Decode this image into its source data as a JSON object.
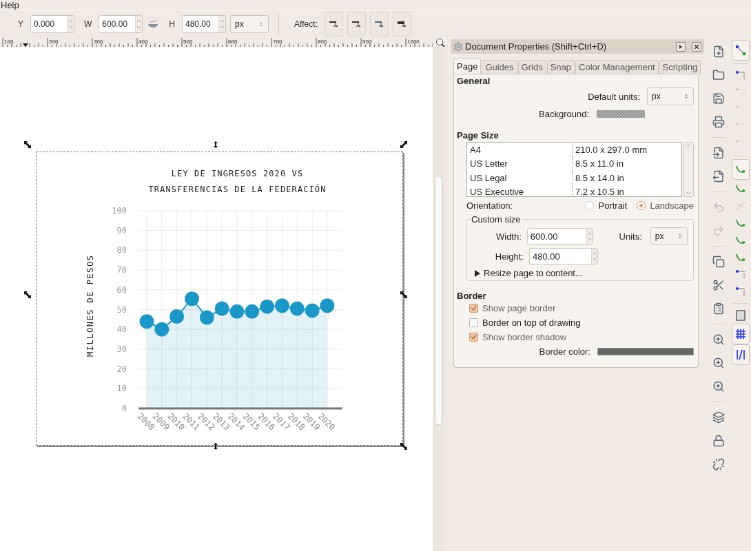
{
  "menu": {
    "items": [
      "Help"
    ]
  },
  "toolbar": {
    "y_label": "Y",
    "y_value": "0.000",
    "w_label": "W",
    "w_value": "600.00",
    "h_label": "H",
    "h_value": "480.00",
    "unit": "px",
    "affect_label": "Affect:"
  },
  "ruler": {
    "labels": [
      "100",
      "200",
      "300",
      "400",
      "500",
      "600",
      "700",
      "800",
      "900",
      "1000"
    ]
  },
  "canvas": {
    "chart_data": {
      "type": "area",
      "title": "LEY DE INGRESOS 2020 VS TRANSFERENCIAS DE LA FEDERACIÓN",
      "ylabel": "MILLONES DE PESOS",
      "categories": [
        "2008",
        "2009",
        "2010",
        "2011",
        "2012",
        "2013",
        "2014",
        "2015",
        "2016",
        "2017",
        "2018",
        "2019",
        "2020"
      ],
      "values": [
        44,
        40,
        46.5,
        55.5,
        46,
        50.5,
        49,
        49,
        51.5,
        52,
        50.5,
        49.5,
        52
      ],
      "color": "#1a97c9",
      "grid": true,
      "ylim": [
        0,
        100
      ],
      "yticks": [
        0,
        10,
        20,
        30,
        40,
        50,
        60,
        70,
        80,
        90,
        100
      ]
    }
  },
  "panel": {
    "title": "Document Properties (Shift+Ctrl+D)",
    "tabs": [
      {
        "label": "Page",
        "selected": true
      },
      {
        "label": "Guides",
        "selected": false
      },
      {
        "label": "Grids",
        "selected": false
      },
      {
        "label": "Snap",
        "selected": false
      },
      {
        "label": "Color Management",
        "selected": false
      },
      {
        "label": "Scripting",
        "selected": false
      }
    ],
    "general_title": "General",
    "default_units_label": "Default units:",
    "default_units_value": "px",
    "background_label": "Background:",
    "page_size_title": "Page Size",
    "page_sizes": [
      {
        "name": "A4",
        "size": "210.0 x 297.0 mm"
      },
      {
        "name": "US Letter",
        "size": "8.5 x 11.0 in"
      },
      {
        "name": "US Legal",
        "size": "8.5 x 14.0 in"
      },
      {
        "name": "US Executive",
        "size": "7.2 x 10.5 in"
      }
    ],
    "orientation_label": "Orientation:",
    "orientations": [
      {
        "label": "Portrait",
        "selected": false
      },
      {
        "label": "Landscape",
        "selected": true
      }
    ],
    "custom_size_title": "Custom size",
    "width_label": "Width:",
    "width_value": "600.00",
    "height_label": "Height:",
    "height_value": "480.00",
    "units_label": "Units:",
    "units_value": "px",
    "resize_label": "Resize page to content...",
    "border_title": "Border",
    "border_options": [
      {
        "label": "Show page border",
        "checked": true
      },
      {
        "label": "Border on top of drawing",
        "checked": false
      },
      {
        "label": "Show border shadow",
        "checked": true
      }
    ],
    "border_color_label": "Border color:"
  },
  "commands": [
    {
      "kind": "new",
      "disabled": false
    },
    {
      "kind": "open",
      "disabled": false
    },
    {
      "kind": "save",
      "disabled": false
    },
    {
      "kind": "print",
      "disabled": false
    },
    {
      "kind": "sep"
    },
    {
      "kind": "import",
      "disabled": false
    },
    {
      "kind": "export",
      "disabled": false
    },
    {
      "kind": "sep"
    },
    {
      "kind": "undo",
      "disabled": true
    },
    {
      "kind": "redo",
      "disabled": true
    },
    {
      "kind": "sep"
    },
    {
      "kind": "copy",
      "disabled": false
    },
    {
      "kind": "cut",
      "disabled": false
    },
    {
      "kind": "paste",
      "disabled": false
    },
    {
      "kind": "sep"
    },
    {
      "kind": "zoom",
      "disabled": false
    },
    {
      "kind": "zoom",
      "disabled": false
    },
    {
      "kind": "zoom",
      "disabled": false
    },
    {
      "kind": "sep"
    },
    {
      "kind": "duplicate",
      "disabled": false
    },
    {
      "kind": "clone",
      "disabled": false
    },
    {
      "kind": "unlink",
      "disabled": false
    }
  ],
  "snap": [
    {
      "kind": "node",
      "on": true,
      "disabled": false
    },
    {
      "kind": "sep"
    },
    {
      "kind": "corner",
      "on": false,
      "disabled": false
    },
    {
      "kind": "corner",
      "on": false,
      "disabled": true
    },
    {
      "kind": "corner",
      "on": false,
      "disabled": true
    },
    {
      "kind": "corner",
      "on": false,
      "disabled": true
    },
    {
      "kind": "corner",
      "on": false,
      "disabled": true
    },
    {
      "kind": "sep"
    },
    {
      "kind": "curve",
      "on": true,
      "disabled": false
    },
    {
      "kind": "curve",
      "on": false,
      "disabled": false
    },
    {
      "kind": "curve",
      "on": false,
      "disabled": true
    },
    {
      "kind": "curve",
      "on": false,
      "disabled": false
    },
    {
      "kind": "curve",
      "on": false,
      "disabled": false
    },
    {
      "kind": "curve",
      "on": false,
      "disabled": false
    },
    {
      "kind": "corner",
      "on": false,
      "disabled": false
    },
    {
      "kind": "corner",
      "on": false,
      "disabled": false
    },
    {
      "kind": "sep"
    },
    {
      "kind": "page",
      "on": false,
      "disabled": false
    },
    {
      "kind": "grid",
      "on": true,
      "disabled": false
    },
    {
      "kind": "guide",
      "on": true,
      "disabled": false
    }
  ]
}
